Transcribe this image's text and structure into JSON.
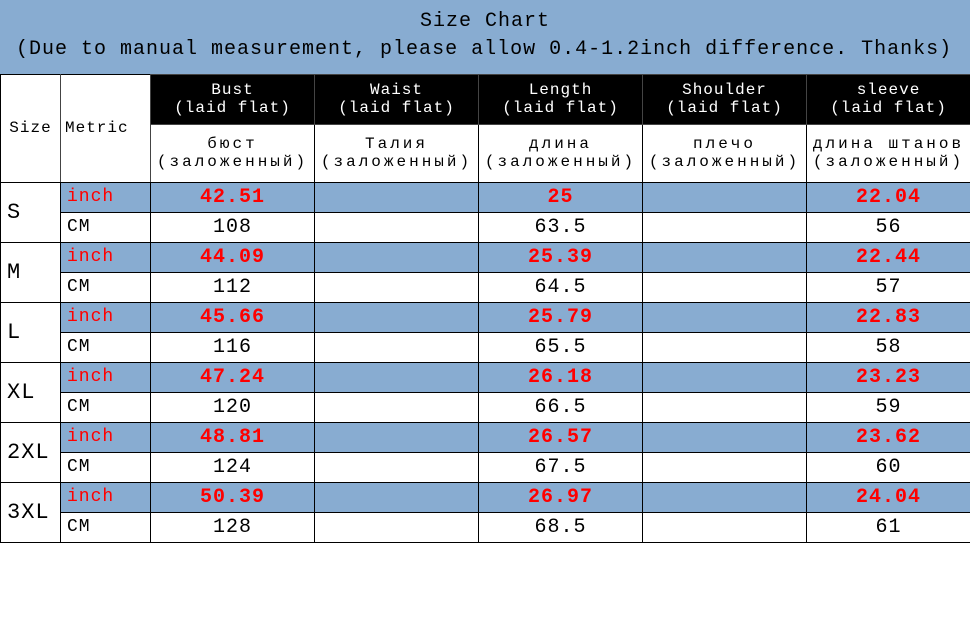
{
  "title": "Size Chart",
  "note": "(Due to manual measurement, please allow 0.4-1.2inch difference. Thanks)",
  "labels": {
    "size": "Size",
    "metric": "Metric",
    "inch": "inch",
    "cm": "CM"
  },
  "columns_en": {
    "bust": "Bust\n(laid flat)",
    "waist": "Waist\n(laid flat)",
    "length": "Length\n(laid flat)",
    "shoulder": "Shoulder\n(laid flat)",
    "sleeve": "sleeve\n(laid flat)"
  },
  "columns_ru": {
    "bust": "бюст (заложенный)",
    "waist": "Талия (заложенный)",
    "length": "длина (заложенный)",
    "shoulder": "плечо (заложенный)",
    "sleeve": "длина штанов (заложенный)"
  },
  "chart_data": {
    "type": "table",
    "sizes": [
      "S",
      "M",
      "L",
      "XL",
      "2XL",
      "3XL"
    ],
    "rows": [
      {
        "inch": {
          "bust": "42.51",
          "waist": "",
          "length": "25",
          "shoulder": "",
          "sleeve": "22.04"
        },
        "cm": {
          "bust": "108",
          "waist": "",
          "length": "63.5",
          "shoulder": "",
          "sleeve": "56"
        }
      },
      {
        "inch": {
          "bust": "44.09",
          "waist": "",
          "length": "25.39",
          "shoulder": "",
          "sleeve": "22.44"
        },
        "cm": {
          "bust": "112",
          "waist": "",
          "length": "64.5",
          "shoulder": "",
          "sleeve": "57"
        }
      },
      {
        "inch": {
          "bust": "45.66",
          "waist": "",
          "length": "25.79",
          "shoulder": "",
          "sleeve": "22.83"
        },
        "cm": {
          "bust": "116",
          "waist": "",
          "length": "65.5",
          "shoulder": "",
          "sleeve": "58"
        }
      },
      {
        "inch": {
          "bust": "47.24",
          "waist": "",
          "length": "26.18",
          "shoulder": "",
          "sleeve": "23.23"
        },
        "cm": {
          "bust": "120",
          "waist": "",
          "length": "66.5",
          "shoulder": "",
          "sleeve": "59"
        }
      },
      {
        "inch": {
          "bust": "48.81",
          "waist": "",
          "length": "26.57",
          "shoulder": "",
          "sleeve": "23.62"
        },
        "cm": {
          "bust": "124",
          "waist": "",
          "length": "67.5",
          "shoulder": "",
          "sleeve": "60"
        }
      },
      {
        "inch": {
          "bust": "50.39",
          "waist": "",
          "length": "26.97",
          "shoulder": "",
          "sleeve": "24.04"
        },
        "cm": {
          "bust": "128",
          "waist": "",
          "length": "68.5",
          "shoulder": "",
          "sleeve": "61"
        }
      }
    ]
  }
}
